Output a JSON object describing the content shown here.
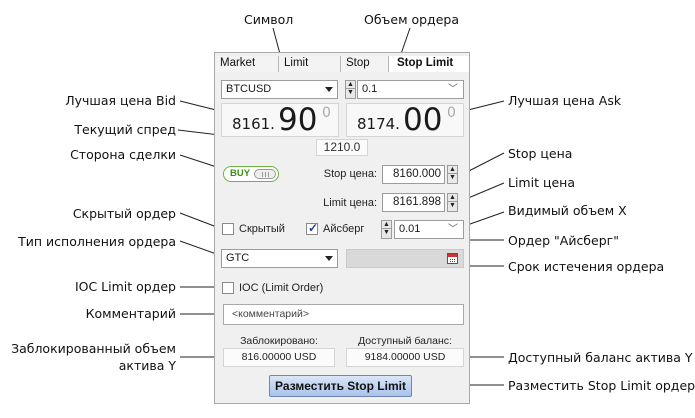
{
  "annotations": {
    "symbol": "Символ",
    "order_volume": "Объем ордера",
    "best_bid": "Лучшая цена Bid",
    "best_ask": "Лучшая цена Ask",
    "current_spread": "Текущий спред",
    "trade_side": "Сторона сделки",
    "stop_price": "Stop цена",
    "limit_price": "Limit цена",
    "visible_volume": "Видимый объем X",
    "hidden_order": "Скрытый ордер",
    "execution_type": "Тип исполнения ордера",
    "iceberg_order": "Ордер \"Айсберг\"",
    "order_expiry": "Срок истечения ордера",
    "ioc_limit_order": "IOC Limit ордер",
    "comment": "Комментарий",
    "blocked_volume_line1": "Заблокированный объем",
    "blocked_volume_line2": "актива Y",
    "available_balance": "Доступный баланс актива Y",
    "place_order": "Разместить Stop Limit ордер"
  },
  "tabs": [
    "Market",
    "Limit",
    "Stop",
    "Stop Limit"
  ],
  "active_tab": "Stop Limit",
  "symbol": {
    "value": "BTCUSD"
  },
  "volume": {
    "value": "0.1"
  },
  "bid": {
    "small": "8161.",
    "big": "90",
    "tiny": "0"
  },
  "ask": {
    "small": "8174.",
    "big": "00",
    "tiny": "0"
  },
  "spread": "1210.0",
  "side": {
    "label": "BUY",
    "color": "#3a8f14"
  },
  "stop_price": {
    "label": "Stop цена:",
    "value": "8160.000"
  },
  "limit_price": {
    "label": "Limit цена:",
    "value": "8161.898"
  },
  "hidden": {
    "label": "Скрытый",
    "checked": false
  },
  "iceberg": {
    "label": "Айсберг",
    "checked": true,
    "visible_volume": "0.01"
  },
  "time_in_force": {
    "value": "GTC"
  },
  "ioc": {
    "label": "IOC (Limit Order)",
    "checked": false
  },
  "comment": {
    "placeholder": "<комментарий>"
  },
  "blocked": {
    "label": "Заблокировано:",
    "value": "816.00000 USD"
  },
  "available": {
    "label": "Доступный баланс:",
    "value": "9184.00000 USD"
  },
  "submit": {
    "label": "Разместить Stop Limit",
    "color": "#a9c1ea"
  },
  "icons": {
    "calendar": "calendar-icon",
    "dropdown": "chevron-down-icon",
    "spinner": "spinner-arrows-icon"
  }
}
